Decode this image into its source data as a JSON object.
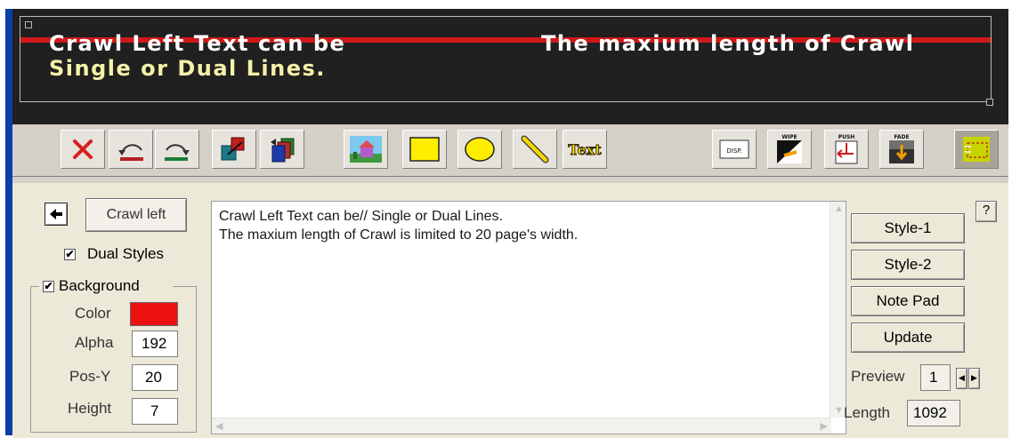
{
  "preview": {
    "line1_left": "Crawl Left Text can be",
    "line1_right": "The maxium length of Crawl",
    "line2": "Single or Dual Lines.",
    "band_color": "#d01818"
  },
  "toolbar": {
    "buttons": [
      {
        "name": "delete-icon"
      },
      {
        "name": "undo-icon"
      },
      {
        "name": "redo-icon"
      },
      {
        "name": "bring-forward-icon"
      },
      {
        "name": "send-backward-icon"
      },
      {
        "name": "image-icon"
      },
      {
        "name": "rectangle-icon"
      },
      {
        "name": "ellipse-icon"
      },
      {
        "name": "line-icon"
      },
      {
        "name": "text-icon",
        "label": "Text"
      },
      {
        "name": "display-icon",
        "label": "DISP."
      },
      {
        "name": "wipe-icon",
        "label": "WIPE"
      },
      {
        "name": "push-icon",
        "label": "PUSH"
      },
      {
        "name": "fade-icon",
        "label": "FADE"
      },
      {
        "name": "crawl-region-icon"
      }
    ]
  },
  "panel": {
    "crawl_button": "Crawl left",
    "dual_styles": "Dual Styles",
    "background_group": "Background",
    "color_label": "Color",
    "color_value": "#ee1111",
    "alpha_label": "Alpha",
    "alpha_value": "192",
    "posy_label": "Pos-Y",
    "posy_value": "20",
    "height_label": "Height",
    "height_value": "7",
    "text_content": "Crawl Left Text can be// Single or Dual Lines.\nThe maxium length of Crawl is limited to 20 page's width.",
    "style1": "Style-1",
    "style2": "Style-2",
    "notepad": "Note Pad",
    "update": "Update",
    "preview_label": "Preview",
    "preview_value": "1",
    "length_label": "Length",
    "length_value": "1092",
    "help": "?"
  }
}
